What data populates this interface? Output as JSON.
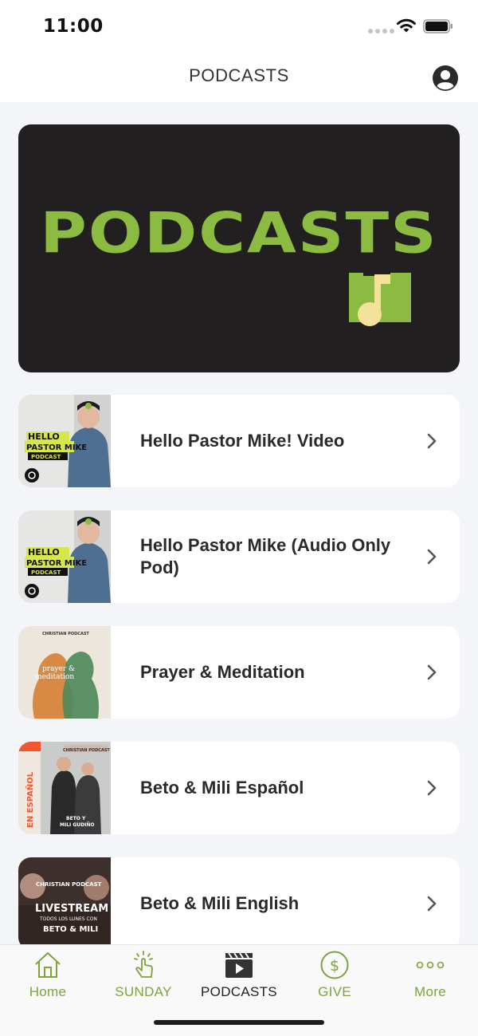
{
  "status_bar": {
    "time": "11:00"
  },
  "nav": {
    "title": "PODCASTS"
  },
  "banner": {
    "title": "PODCASTS",
    "colors": {
      "background": "#221f20",
      "accent": "#8bbb41",
      "note": "#f5e29a"
    }
  },
  "podcasts": [
    {
      "label": "Hello Pastor Mike! Video",
      "thumb": {
        "line1": "HELLO",
        "line2": "PASTOR MIKE",
        "tag": "PODCAST"
      }
    },
    {
      "label": "Hello Pastor Mike (Audio Only Pod)",
      "thumb": {
        "line1": "HELLO",
        "line2": "PASTOR MIKE",
        "tag": "PODCAST"
      }
    },
    {
      "label": "Prayer & Meditation",
      "thumb": {
        "brand": "CHRISTIAN PODCAST",
        "line1": "prayer &",
        "line2": "meditation"
      }
    },
    {
      "label": "Beto & Mili Español",
      "thumb": {
        "brand": "CHRISTIAN PODCAST",
        "side": "EN ESPAÑOL",
        "line1": "BETO Y",
        "line2": "MILI GUDIÑO"
      }
    },
    {
      "label": "Beto & Mili English",
      "thumb": {
        "brand": "CHRISTIAN PODCAST",
        "line1": "LIVESTREAM",
        "line2": "TODOS LOS LUNES CON",
        "line3": "BETO & MILI"
      }
    }
  ],
  "tabs": [
    {
      "label": "Home",
      "icon": "home-icon"
    },
    {
      "label": "SUNDAY",
      "icon": "tap-icon"
    },
    {
      "label": "PODCASTS",
      "icon": "clapperboard-icon",
      "active": true
    },
    {
      "label": "GIVE",
      "icon": "dollar-icon"
    },
    {
      "label": "More",
      "icon": "more-dots-icon"
    }
  ],
  "colors": {
    "tab_accent": "#7ea23c",
    "background": "#f4f5f9"
  }
}
